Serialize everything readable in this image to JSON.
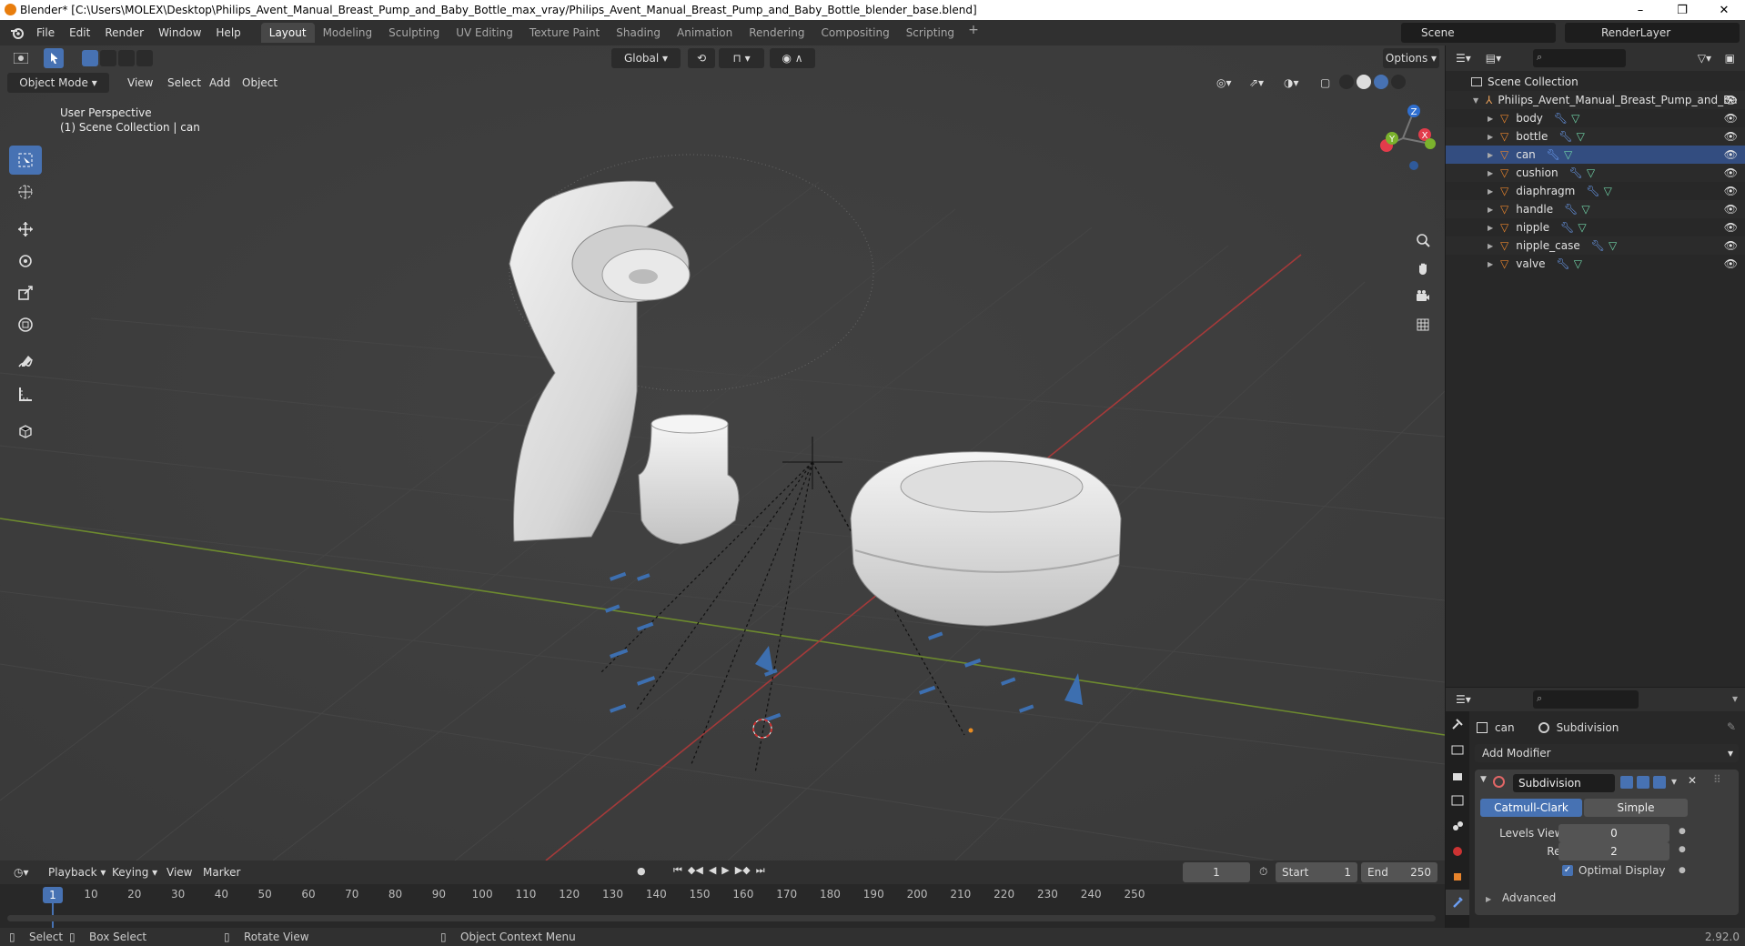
{
  "window": {
    "title": "Blender* [C:\\Users\\MOLEX\\Desktop\\Philips_Avent_Manual_Breast_Pump_and_Baby_Bottle_max_vray/Philips_Avent_Manual_Breast_Pump_and_Baby_Bottle_blender_base.blend]",
    "controls": [
      "–",
      "❐",
      "✕"
    ]
  },
  "menu": [
    "File",
    "Edit",
    "Render",
    "Window",
    "Help"
  ],
  "workspaces": [
    "Layout",
    "Modeling",
    "Sculpting",
    "UV Editing",
    "Texture Paint",
    "Shading",
    "Animation",
    "Rendering",
    "Compositing",
    "Scripting"
  ],
  "active_workspace": "Layout",
  "scene": "Scene",
  "render_layer": "RenderLayer",
  "viewport": {
    "transform_orientation": "Global",
    "options_label": "Options",
    "mode": "Object Mode",
    "menus": [
      "View",
      "Select",
      "Add",
      "Object"
    ],
    "overlay_line1": "User Perspective",
    "overlay_line2": "(1) Scene Collection | can",
    "gizmo": {
      "z": "Z",
      "y": "Y",
      "x": "X"
    }
  },
  "outliner": {
    "root": "Scene Collection",
    "collection": "Philips_Avent_Manual_Breast_Pump_and_Ba",
    "objects": [
      "body",
      "bottle",
      "can",
      "cushion",
      "diaphragm",
      "handle",
      "nipple",
      "nipple_case",
      "valve"
    ],
    "selected": "can"
  },
  "properties": {
    "object": "can",
    "modifier_crumb": "Subdivision",
    "add_modifier": "Add Modifier",
    "modifier_name": "Subdivision",
    "seg_a": "Catmull-Clark",
    "seg_b": "Simple",
    "levels_viewport_label": "Levels Viewport",
    "levels_viewport_value": "0",
    "render_label": "Render",
    "render_value": "2",
    "optimal_display": "Optimal Display",
    "advanced": "Advanced"
  },
  "timeline": {
    "menus": [
      "Playback",
      "Keying",
      "View",
      "Marker"
    ],
    "current_frame": "1",
    "start_label": "Start",
    "start_value": "1",
    "end_label": "End",
    "end_value": "250",
    "ticks": [
      "10",
      "20",
      "30",
      "40",
      "50",
      "60",
      "70",
      "80",
      "90",
      "100",
      "110",
      "120",
      "130",
      "140",
      "150",
      "160",
      "170",
      "180",
      "190",
      "200",
      "210",
      "220",
      "230",
      "240",
      "250"
    ],
    "frame_marker": "1"
  },
  "statusbar": {
    "select": "Select",
    "box_select": "Box Select",
    "rotate_view": "Rotate View",
    "context_menu": "Object Context Menu",
    "version": "2.92.0"
  },
  "colors": {
    "accent": "#4772b3",
    "object_orange": "#e8842c",
    "modifier_blue": "#6b9df1",
    "mesh_green": "#6fd1a6"
  }
}
